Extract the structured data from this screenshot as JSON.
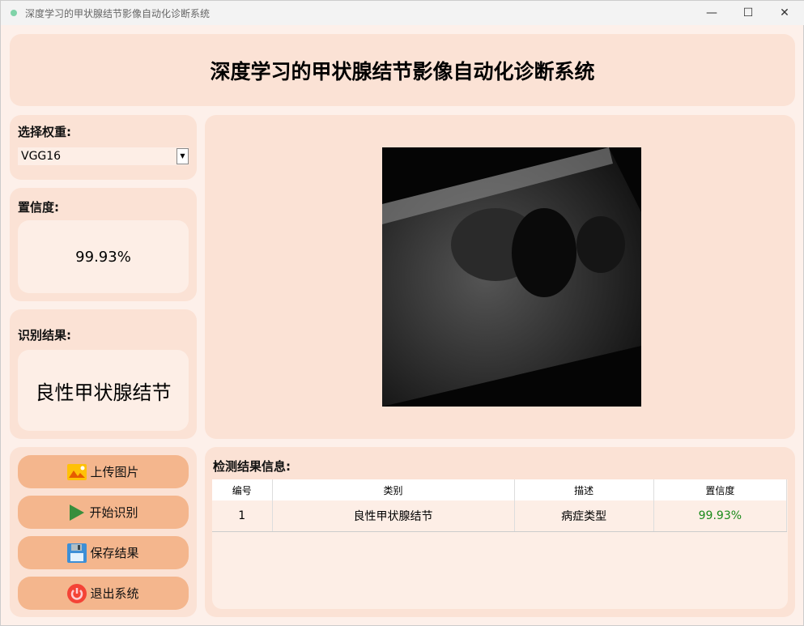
{
  "window": {
    "title": "深度学习的甲状腺结节影像自动化诊断系统"
  },
  "header": {
    "title": "深度学习的甲状腺结节影像自动化诊断系统"
  },
  "weight": {
    "label": "选择权重:",
    "selected": "VGG16"
  },
  "confidence": {
    "label": "置信度:",
    "value": "99.93%"
  },
  "result": {
    "label": "识别结果:",
    "value": "良性甲状腺结节"
  },
  "buttons": [
    {
      "label": "上传图片",
      "icon": "image-icon"
    },
    {
      "label": "开始识别",
      "icon": "play-icon"
    },
    {
      "label": "保存结果",
      "icon": "save-icon"
    },
    {
      "label": "退出系统",
      "icon": "power-icon"
    }
  ],
  "table": {
    "title": "检测结果信息:",
    "headers": [
      "编号",
      "类别",
      "描述",
      "置信度"
    ],
    "rows": [
      [
        "1",
        "良性甲状腺结节",
        "病症类型",
        "99.93%"
      ]
    ]
  },
  "colors": {
    "confidence_text": "#1a8a1a"
  }
}
